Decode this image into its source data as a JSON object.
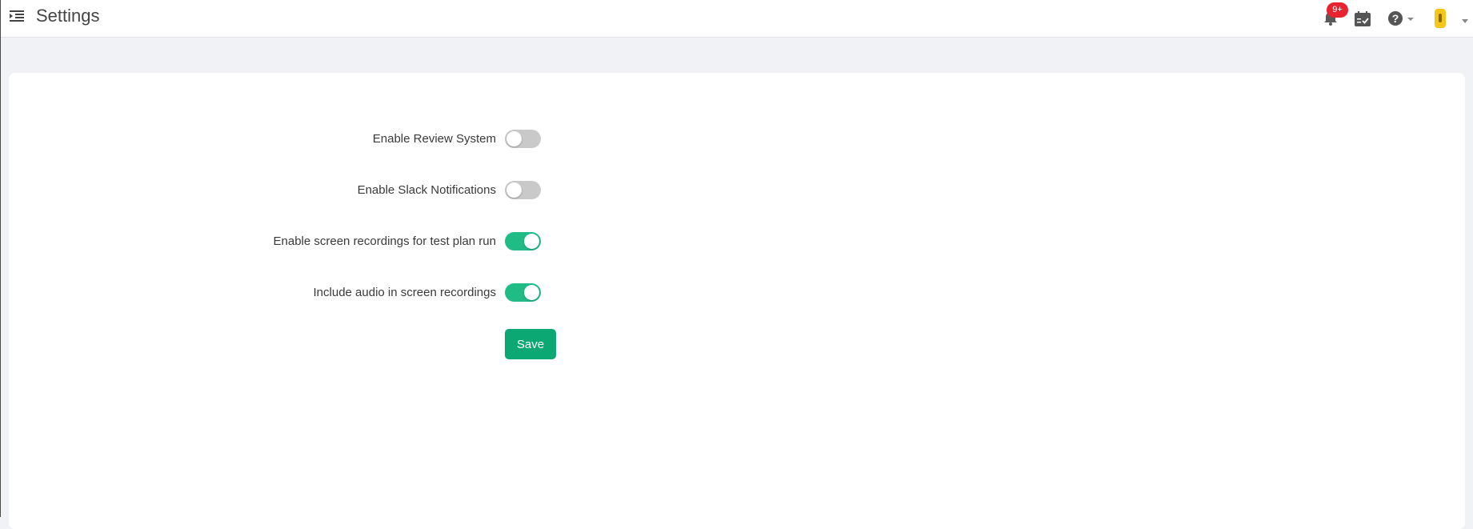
{
  "header": {
    "title": "Settings",
    "menu_icon": "indent-menu-icon",
    "notification_badge": "9+",
    "icons": [
      "bell-icon",
      "calendar-check-icon",
      "help-icon",
      "chevron-down-icon",
      "user-avatar-icon"
    ]
  },
  "settings": [
    {
      "label": "Enable Review System",
      "enabled": false
    },
    {
      "label": "Enable Slack Notifications",
      "enabled": false
    },
    {
      "label": "Enable screen recordings for test plan run",
      "enabled": true
    },
    {
      "label": "Include audio in screen recordings",
      "enabled": true
    }
  ],
  "actions": {
    "save_label": "Save"
  },
  "colors": {
    "toggle_on": "#1fbd85",
    "toggle_off": "#c9c9c9",
    "save_button": "#0ba873",
    "badge": "#e8222e",
    "avatar": "#f5c518"
  }
}
